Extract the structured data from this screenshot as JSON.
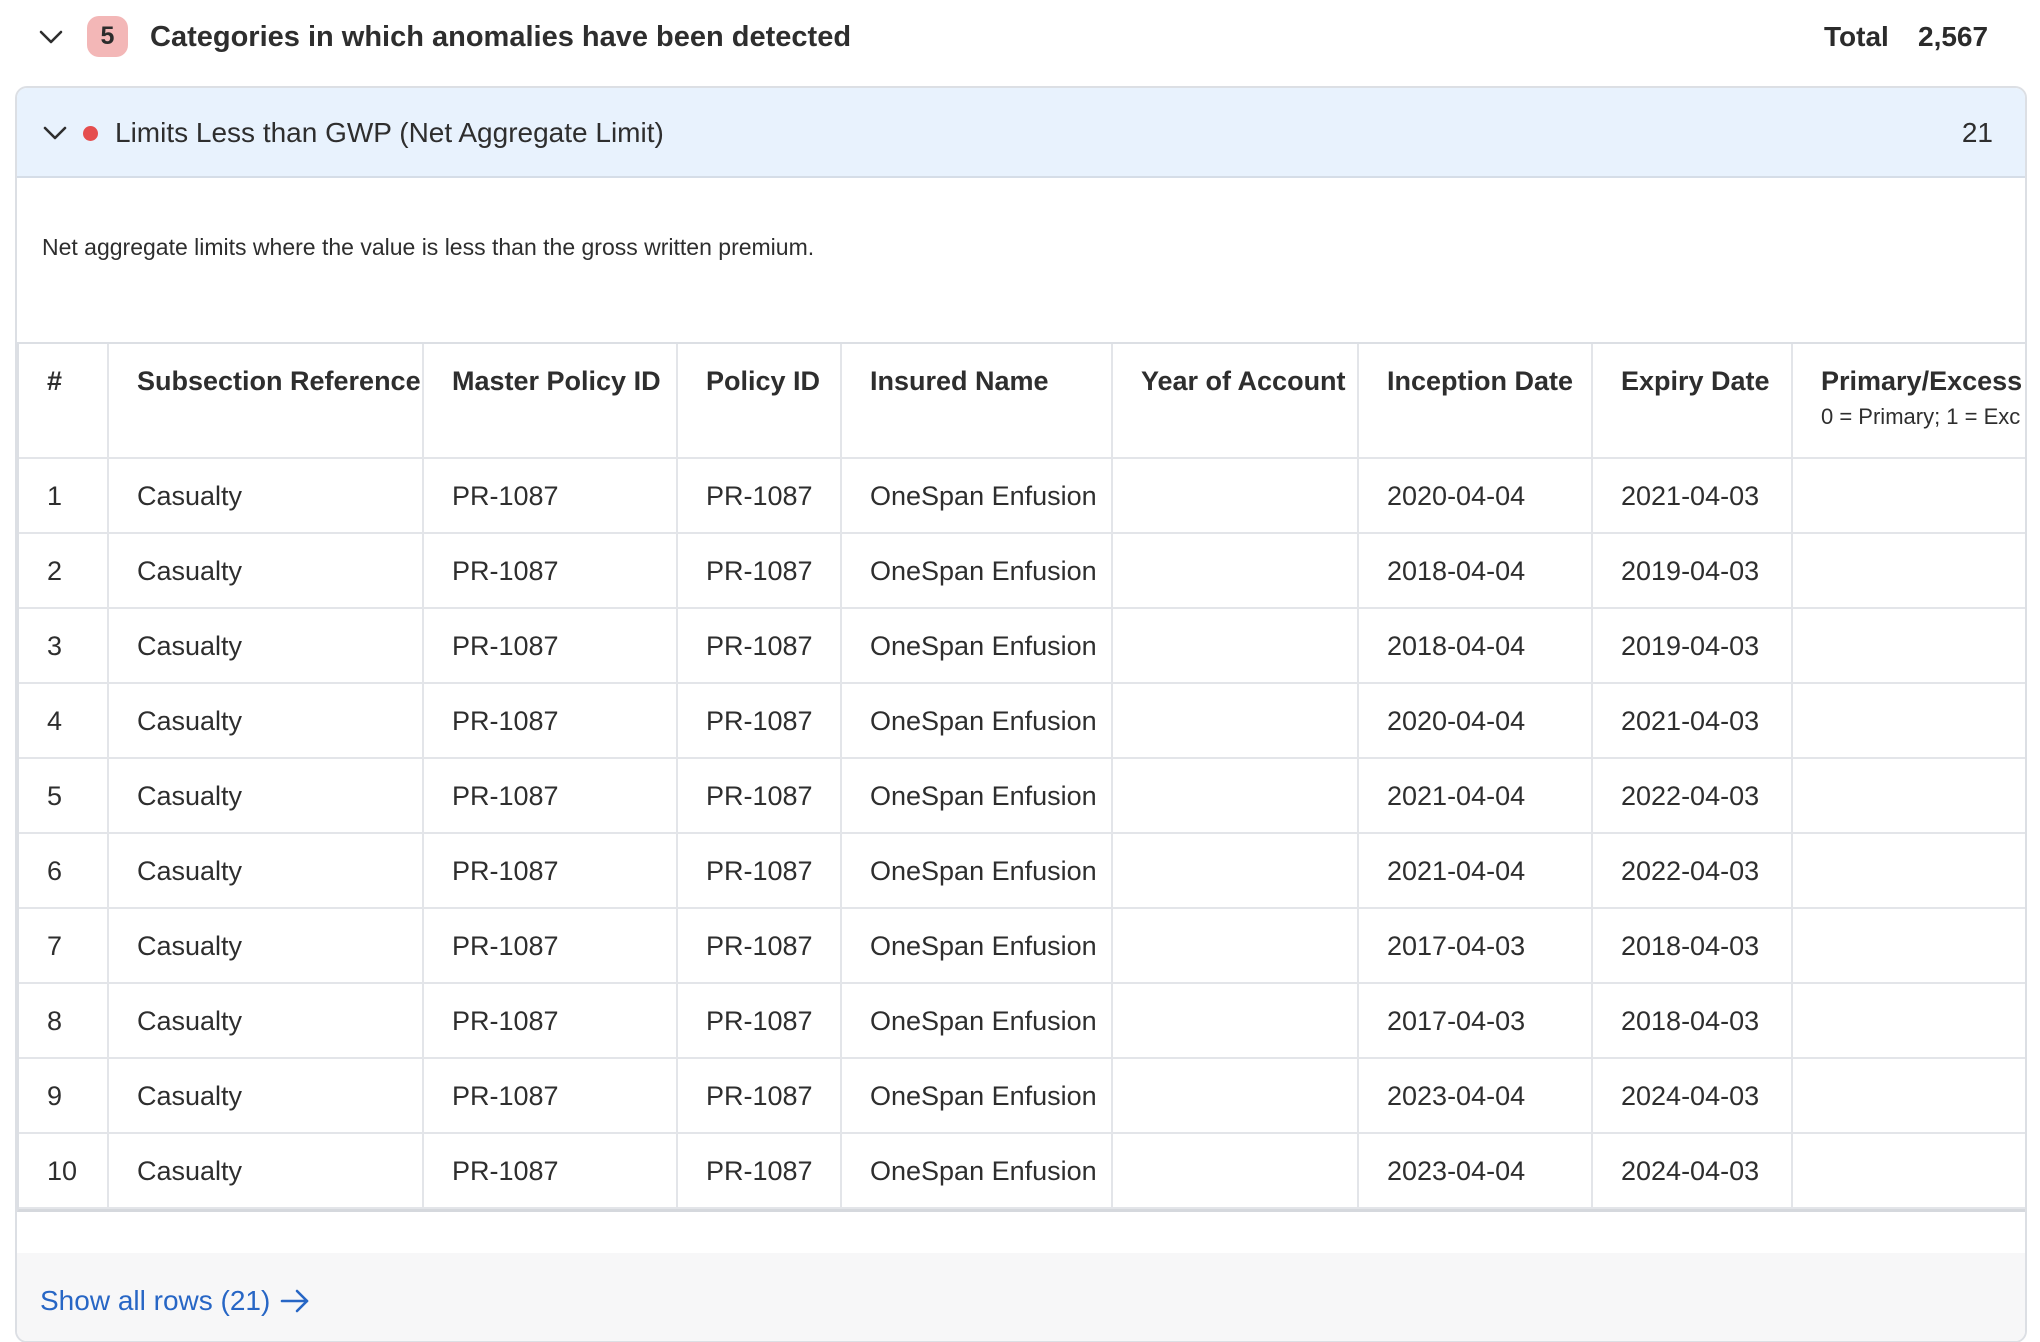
{
  "header": {
    "badge_count": "5",
    "title": "Categories in which anomalies have been detected",
    "total_label": "Total",
    "total_value": "2,567"
  },
  "category": {
    "title": "Limits Less than GWP (Net Aggregate Limit)",
    "count": "21",
    "description": "Net aggregate limits where the value is less than the gross written premium.",
    "dot_color": "#e54e4e"
  },
  "table": {
    "columns": [
      {
        "label": "#",
        "sub": ""
      },
      {
        "label": "Subsection Reference",
        "sub": ""
      },
      {
        "label": "Master Policy ID",
        "sub": ""
      },
      {
        "label": "Policy ID",
        "sub": ""
      },
      {
        "label": "Insured Name",
        "sub": ""
      },
      {
        "label": "Year of Account",
        "sub": ""
      },
      {
        "label": "Inception Date",
        "sub": ""
      },
      {
        "label": "Expiry Date",
        "sub": ""
      },
      {
        "label": "Primary/Excess",
        "sub": "0 = Primary; 1 = Exc"
      }
    ],
    "rows": [
      [
        "1",
        "Casualty",
        "PR-1087",
        "PR-1087",
        "OneSpan Enfusion",
        "",
        "2020-04-04",
        "2021-04-03",
        ""
      ],
      [
        "2",
        "Casualty",
        "PR-1087",
        "PR-1087",
        "OneSpan Enfusion",
        "",
        "2018-04-04",
        "2019-04-03",
        ""
      ],
      [
        "3",
        "Casualty",
        "PR-1087",
        "PR-1087",
        "OneSpan Enfusion",
        "",
        "2018-04-04",
        "2019-04-03",
        ""
      ],
      [
        "4",
        "Casualty",
        "PR-1087",
        "PR-1087",
        "OneSpan Enfusion",
        "",
        "2020-04-04",
        "2021-04-03",
        ""
      ],
      [
        "5",
        "Casualty",
        "PR-1087",
        "PR-1087",
        "OneSpan Enfusion",
        "",
        "2021-04-04",
        "2022-04-03",
        ""
      ],
      [
        "6",
        "Casualty",
        "PR-1087",
        "PR-1087",
        "OneSpan Enfusion",
        "",
        "2021-04-04",
        "2022-04-03",
        ""
      ],
      [
        "7",
        "Casualty",
        "PR-1087",
        "PR-1087",
        "OneSpan Enfusion",
        "",
        "2017-04-03",
        "2018-04-03",
        ""
      ],
      [
        "8",
        "Casualty",
        "PR-1087",
        "PR-1087",
        "OneSpan Enfusion",
        "",
        "2017-04-03",
        "2018-04-03",
        ""
      ],
      [
        "9",
        "Casualty",
        "PR-1087",
        "PR-1087",
        "OneSpan Enfusion",
        "",
        "2023-04-04",
        "2024-04-03",
        ""
      ],
      [
        "10",
        "Casualty",
        "PR-1087",
        "PR-1087",
        "OneSpan Enfusion",
        "",
        "2023-04-04",
        "2024-04-03",
        ""
      ]
    ]
  },
  "footer": {
    "show_all_label": "Show all rows (21)"
  },
  "icons": {
    "collapse": "chevron-down-icon",
    "arrow": "arrow-right-icon"
  }
}
